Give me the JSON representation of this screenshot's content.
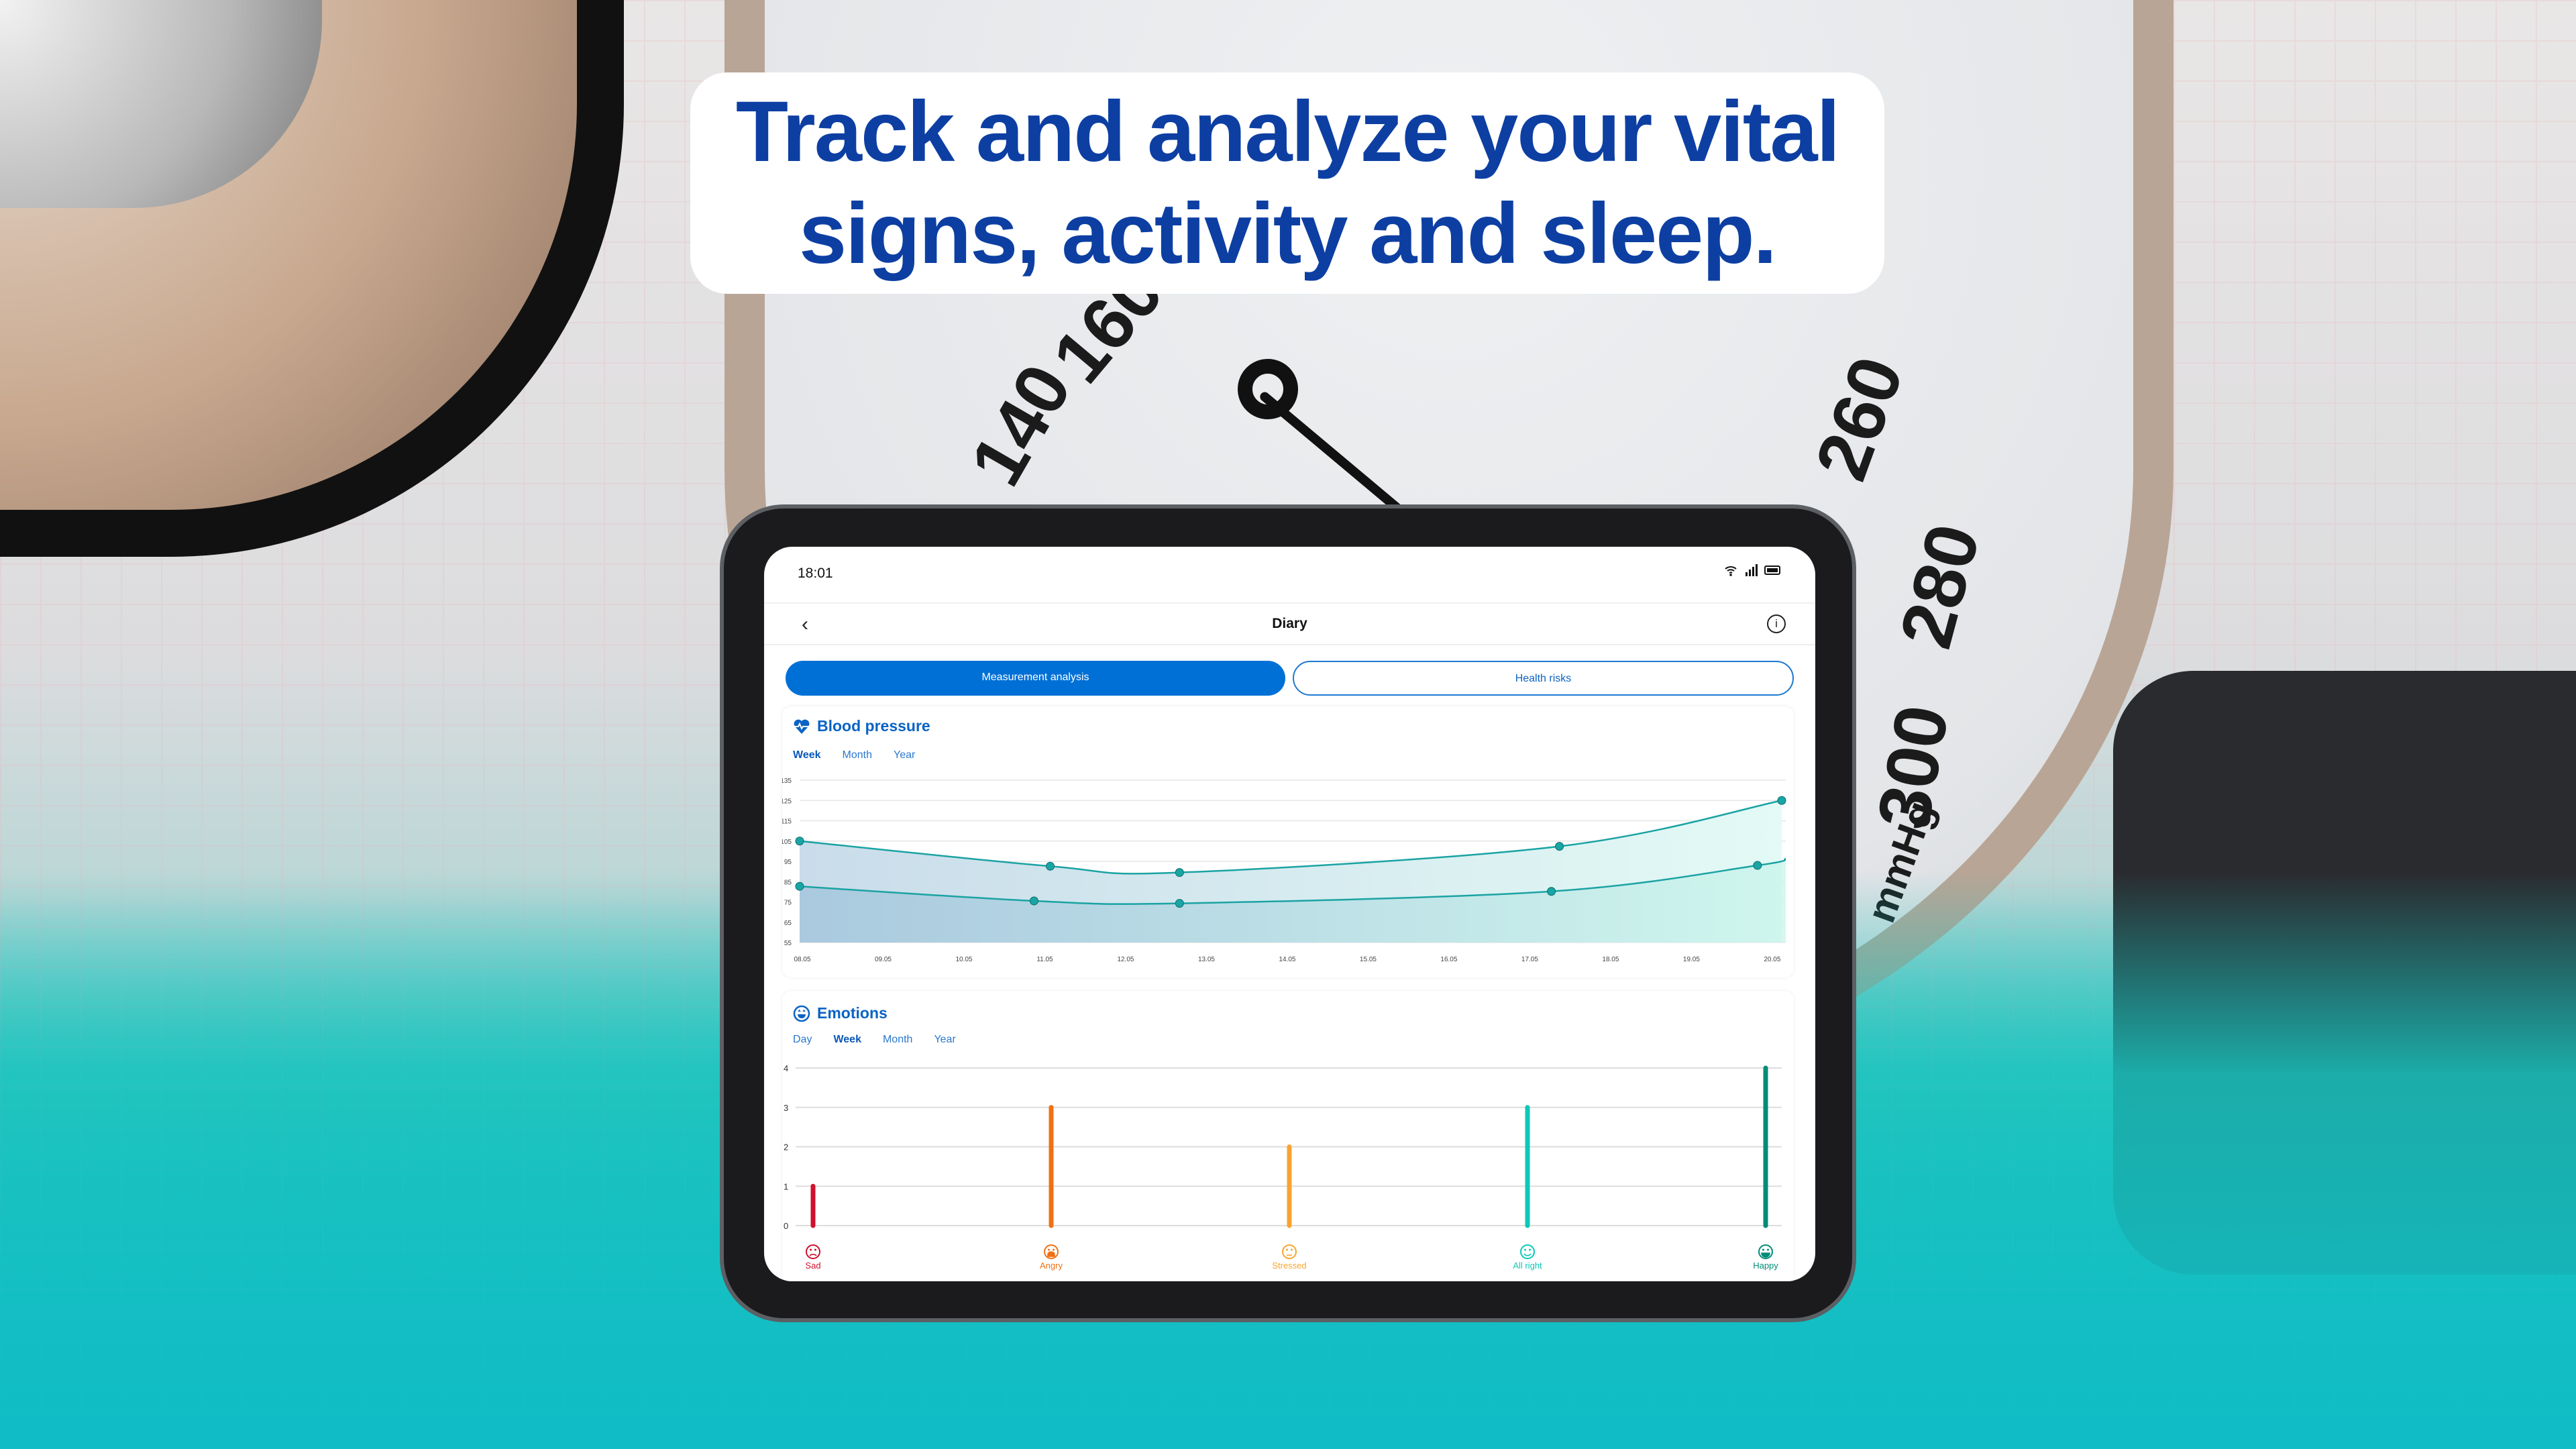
{
  "headline": "Track and analyze your vital signs, activity and sleep.",
  "background": {
    "gauge_numbers": [
      "140",
      "160",
      "260",
      "280",
      "300",
      "mmHg"
    ]
  },
  "status_bar": {
    "time": "18:01",
    "icons": [
      "wifi-icon",
      "signal-icon",
      "battery-icon"
    ]
  },
  "header": {
    "title": "Diary",
    "back_icon": "chevron-left-icon",
    "info_icon": "info-icon",
    "info_glyph": "i",
    "back_glyph": "‹"
  },
  "tabs": [
    {
      "label": "Measurement analysis",
      "active": true
    },
    {
      "label": "Health risks",
      "active": false
    }
  ],
  "colors": {
    "accent": "#0070d6",
    "line": "#1ba3a3",
    "sad": "#d0102e",
    "angry": "#f07014",
    "stressed": "#f8a430",
    "allright": "#0cc8b8",
    "happy": "#008c78"
  },
  "blood_pressure": {
    "title": "Blood pressure",
    "icon": "heart-pulse-icon",
    "periods": [
      "Week",
      "Month",
      "Year"
    ],
    "active_period": "Week"
  },
  "emotions": {
    "title": "Emotions",
    "icon": "smiley-icon",
    "periods": [
      "Day",
      "Week",
      "Month",
      "Year"
    ],
    "active_period": "Week"
  },
  "chart_data": [
    {
      "type": "line",
      "title": "Blood pressure",
      "ylim": [
        55,
        135
      ],
      "yticks": [
        135,
        125,
        115,
        105,
        95,
        85,
        75,
        65,
        55
      ],
      "xticks": [
        "08.05",
        "09.05",
        "10.05",
        "11.05",
        "12.05",
        "13.05",
        "14.05",
        "15.05",
        "16.05",
        "17.05",
        "18.05",
        "19.05",
        "20.05"
      ],
      "grid": true,
      "series": [
        {
          "points": [
            [
              "08.05",
              105
            ],
            [
              "11.05",
              92.6
            ],
            [
              "12.05",
              89.5
            ],
            [
              "17.05",
              102.4
            ],
            [
              "20.05",
              125
            ]
          ],
          "x": [
            8.0,
            11.1,
            12.7,
            17.4,
            20.15
          ]
        },
        {
          "points": [
            [
              "08.05",
              82.7
            ],
            [
              "10.05",
              75.5
            ],
            [
              "12.05",
              74.3
            ],
            [
              "17.05",
              80.2
            ],
            [
              "19.05",
              93
            ]
          ],
          "x": [
            8.0,
            10.9,
            12.7,
            17.3,
            19.85
          ]
        }
      ]
    },
    {
      "type": "bar",
      "title": "Emotions",
      "ylim": [
        0,
        4
      ],
      "yticks": [
        4,
        3,
        2,
        1,
        0
      ],
      "grid": true,
      "categories": [
        "Sad",
        "Angry",
        "Stressed",
        "All right",
        "Happy"
      ],
      "values": [
        1,
        3,
        2,
        3,
        4
      ]
    }
  ]
}
